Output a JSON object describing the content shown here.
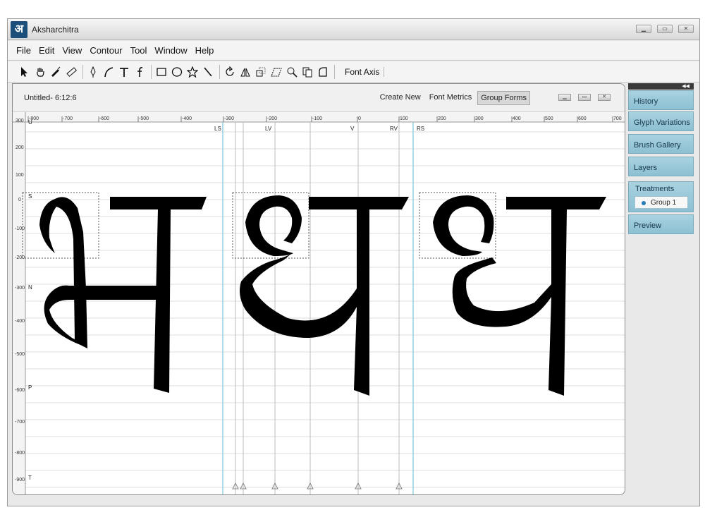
{
  "app": {
    "title": "Aksharchitra",
    "logo": "अ",
    "window_buttons": [
      "minimize-icon",
      "maximize-icon",
      "close-icon"
    ]
  },
  "menu": [
    "File",
    "Edit",
    "View",
    "Contour",
    "Tool",
    "Window",
    "Help"
  ],
  "toolbar": {
    "tools": [
      "pointer-icon",
      "hand-icon",
      "pen-nib-icon",
      "ruler-icon",
      "pen-icon",
      "curve-icon",
      "t-bar-icon",
      "f-stroke-icon",
      "rectangle-icon",
      "ellipse-icon",
      "star-icon",
      "line-icon",
      "rotate-icon",
      "reflect-icon",
      "scale-icon",
      "skew-icon",
      "zoom-icon",
      "copy-icon",
      "shape-icon"
    ],
    "font_axis_label": "Font Axis"
  },
  "document": {
    "title": "Untitled- 6:12:6",
    "actions": [
      "Create New",
      "Font Metrics",
      "Group Forms"
    ],
    "active_action": "Group Forms"
  },
  "ruler": {
    "top_labels": [
      "-800",
      "-700",
      "-600",
      "-500",
      "-400",
      "-300",
      "-200",
      "-100",
      "0",
      "100",
      "200",
      "300",
      "400",
      "500",
      "600",
      "700"
    ],
    "left_labels": [
      "300",
      "200",
      "100",
      "0",
      "-100",
      "-200",
      "-300",
      "-400",
      "-500",
      "-600",
      "-700",
      "-800",
      "-900"
    ]
  },
  "guides": {
    "vertical": [
      "LS",
      "LV",
      "V",
      "RV",
      "RS"
    ],
    "horizontal": [
      "U",
      "S",
      "N",
      "P",
      "T"
    ]
  },
  "side_panel": {
    "tabs": [
      "History",
      "Glyph Variations",
      "Brush Gallery",
      "Layers"
    ],
    "group_label": "Treatments",
    "group_item": "Group 1",
    "bottom_tab": "Preview"
  },
  "colors": {
    "accent_panel": "#9ecadb",
    "guide_cyan": "#7cc6d8",
    "glyph": "#000000"
  }
}
